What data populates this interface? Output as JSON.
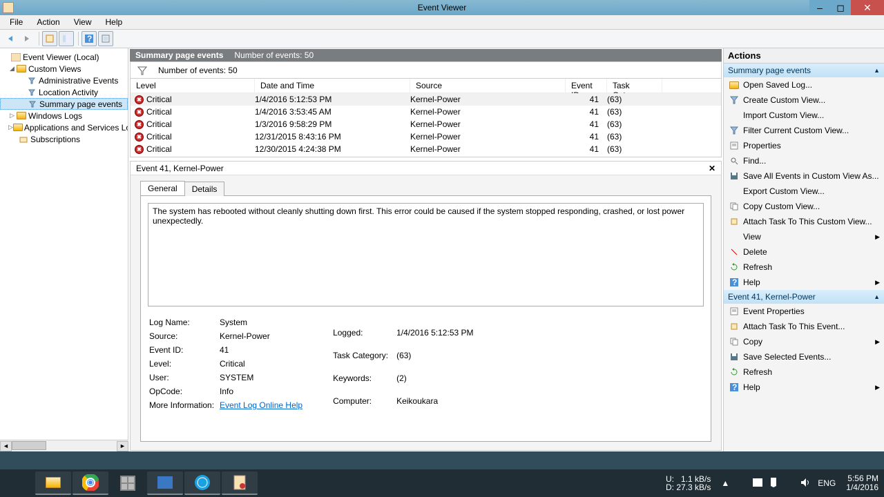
{
  "window": {
    "title": "Event Viewer"
  },
  "menu": [
    "File",
    "Action",
    "View",
    "Help"
  ],
  "tree": {
    "root": "Event Viewer (Local)",
    "custom": "Custom Views",
    "admin": "Administrative Events",
    "loc": "Location Activity",
    "summary": "Summary page events",
    "win": "Windows Logs",
    "apps": "Applications and Services Logs",
    "subs": "Subscriptions"
  },
  "centerhdr": {
    "title": "Summary page events",
    "count": "Number of events: 50"
  },
  "filterbar": {
    "count": "Number of events: 50"
  },
  "columns": {
    "level": "Level",
    "dt": "Date and Time",
    "src": "Source",
    "eid": "Event ID",
    "tc": "Task Category"
  },
  "rows": [
    {
      "level": "Critical",
      "dt": "1/4/2016 5:12:53 PM",
      "src": "Kernel-Power",
      "eid": "41",
      "tc": "(63)"
    },
    {
      "level": "Critical",
      "dt": "1/4/2016 3:53:45 AM",
      "src": "Kernel-Power",
      "eid": "41",
      "tc": "(63)"
    },
    {
      "level": "Critical",
      "dt": "1/3/2016 9:58:29 PM",
      "src": "Kernel-Power",
      "eid": "41",
      "tc": "(63)"
    },
    {
      "level": "Critical",
      "dt": "12/31/2015 8:43:16 PM",
      "src": "Kernel-Power",
      "eid": "41",
      "tc": "(63)"
    },
    {
      "level": "Critical",
      "dt": "12/30/2015 4:24:38 PM",
      "src": "Kernel-Power",
      "eid": "41",
      "tc": "(63)"
    }
  ],
  "detail": {
    "title": "Event 41, Kernel-Power",
    "tabs": {
      "general": "General",
      "details": "Details"
    },
    "msg": "The system has rebooted without cleanly shutting down first. This error could be caused if the system stopped responding, crashed, or lost power unexpectedly.",
    "props": {
      "logname_k": "Log Name:",
      "logname_v": "System",
      "src_k": "Source:",
      "src_v": "Kernel-Power",
      "eid_k": "Event ID:",
      "eid_v": "41",
      "lvl_k": "Level:",
      "lvl_v": "Critical",
      "user_k": "User:",
      "user_v": "SYSTEM",
      "op_k": "OpCode:",
      "op_v": "Info",
      "more_k": "More Information:",
      "more_v": "Event Log Online Help",
      "logged_k": "Logged:",
      "logged_v": "1/4/2016 5:12:53 PM",
      "tc_k": "Task Category:",
      "tc_v": "(63)",
      "kw_k": "Keywords:",
      "kw_v": "(2)",
      "comp_k": "Computer:",
      "comp_v": "Keikoukara"
    }
  },
  "actions": {
    "header": "Actions",
    "grp1": "Summary page events",
    "grp2": "Event 41, Kernel-Power",
    "g1": [
      "Open Saved Log...",
      "Create Custom View...",
      "Import Custom View...",
      "Filter Current Custom View...",
      "Properties",
      "Find...",
      "Save All Events in Custom View As...",
      "Export Custom View...",
      "Copy Custom View...",
      "Attach Task To This Custom View...",
      "View",
      "Delete",
      "Refresh",
      "Help"
    ],
    "g2": [
      "Event Properties",
      "Attach Task To This Event...",
      "Copy",
      "Save Selected Events...",
      "Refresh",
      "Help"
    ]
  },
  "tray": {
    "up": "1.1 kB/s",
    "down": "27.3 kB/s",
    "u": "U:",
    "d": "D:",
    "lang": "ENG",
    "time": "5:56 PM",
    "date": "1/4/2016"
  }
}
